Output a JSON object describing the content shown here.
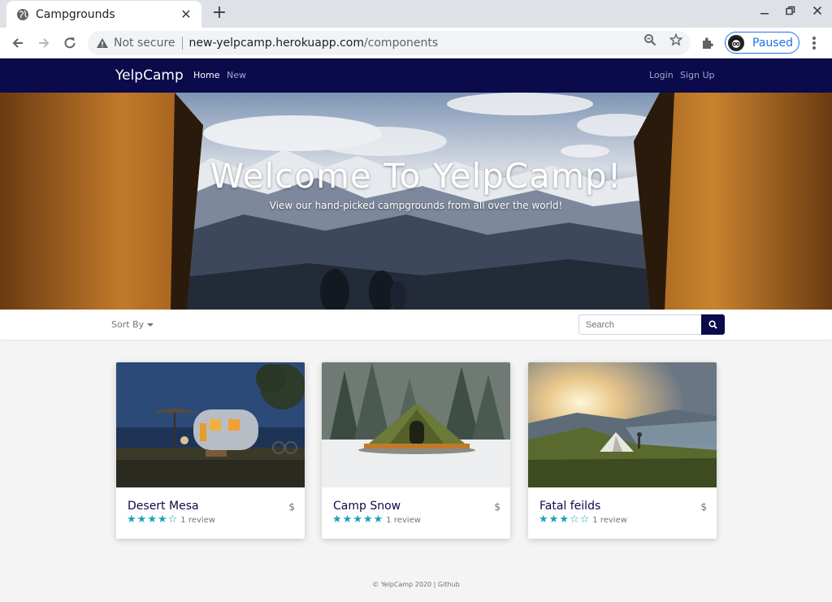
{
  "browser": {
    "tab_title": "Campgrounds",
    "not_secure": "Not secure",
    "url_host": "new-yelpcamp.herokuapp.com",
    "url_path": "/components",
    "profile_label": "Paused"
  },
  "navbar": {
    "brand": "YelpCamp",
    "links": [
      "Home",
      "New"
    ],
    "right_links": [
      "Login",
      "Sign Up"
    ]
  },
  "hero": {
    "title": "Welcome To YelpCamp!",
    "subtitle": "View our hand-picked campgrounds from all over the world!"
  },
  "filters": {
    "sort_label": "Sort By",
    "search_placeholder": "Search"
  },
  "campgrounds": [
    {
      "name": "Desert Mesa",
      "price": "$",
      "rating": 4,
      "review_text": "1 review"
    },
    {
      "name": "Camp Snow",
      "price": "$",
      "rating": 5,
      "review_text": "1 review"
    },
    {
      "name": "Fatal feilds",
      "price": "$",
      "rating": 3,
      "review_text": "1 review"
    }
  ],
  "footer": {
    "text": "© YelpCamp 2020 | Github"
  },
  "colors": {
    "navbar": "#0b0a4a",
    "star": "#17a2b8",
    "link_muted": "#a5a6cf"
  }
}
